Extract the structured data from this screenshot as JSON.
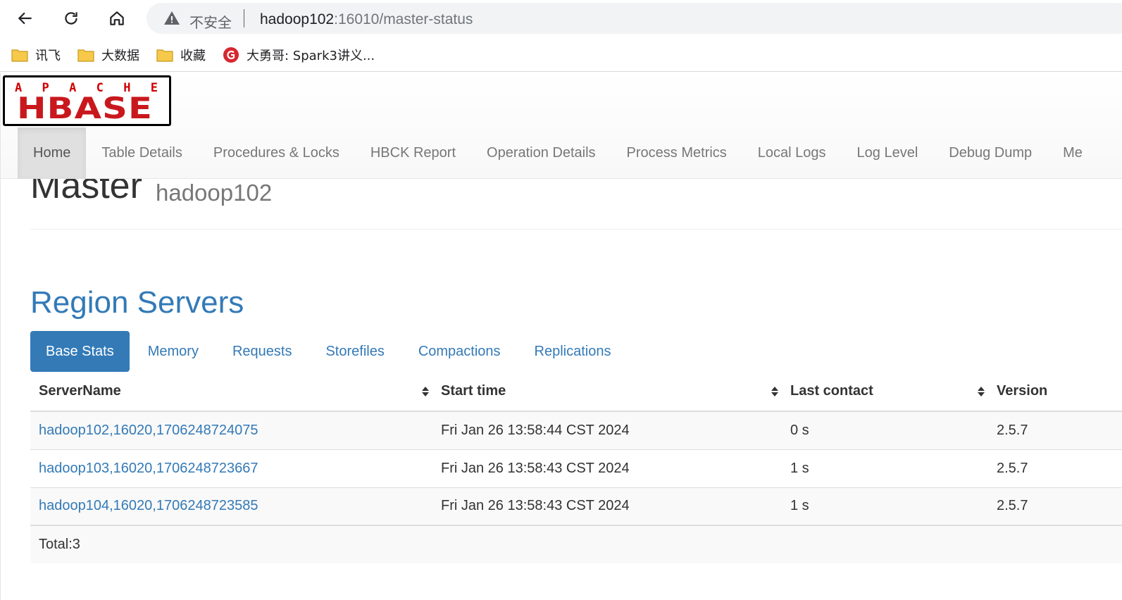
{
  "browser": {
    "insecure_label": "不安全",
    "url_host": "hadoop102",
    "url_rest": ":16010/master-status",
    "bookmarks": [
      {
        "label": "讯飞",
        "icon": "folder-icon"
      },
      {
        "label": "大数据",
        "icon": "folder-icon"
      },
      {
        "label": "收藏",
        "icon": "folder-icon"
      },
      {
        "label": "大勇哥: Spark3讲义...",
        "icon": "site-g-icon"
      }
    ]
  },
  "logo": {
    "top": "APACHE",
    "bottom": "HBASE"
  },
  "menu": [
    {
      "label": "Home"
    },
    {
      "label": "Table Details"
    },
    {
      "label": "Procedures & Locks"
    },
    {
      "label": "HBCK Report"
    },
    {
      "label": "Operation Details"
    },
    {
      "label": "Process Metrics"
    },
    {
      "label": "Local Logs"
    },
    {
      "label": "Log Level"
    },
    {
      "label": "Debug Dump"
    },
    {
      "label": "Me"
    }
  ],
  "master": {
    "title": "Master",
    "host": "hadoop102"
  },
  "region_servers": {
    "title": "Region Servers",
    "tabs": [
      "Base Stats",
      "Memory",
      "Requests",
      "Storefiles",
      "Compactions",
      "Replications"
    ],
    "columns": [
      "ServerName",
      "Start time",
      "Last contact",
      "Version"
    ],
    "rows": [
      {
        "server": "hadoop102,16020,1706248724075",
        "start": "Fri Jan 26 13:58:44 CST 2024",
        "contact": "0 s",
        "version": "2.5.7"
      },
      {
        "server": "hadoop103,16020,1706248723667",
        "start": "Fri Jan 26 13:58:43 CST 2024",
        "contact": "1 s",
        "version": "2.5.7"
      },
      {
        "server": "hadoop104,16020,1706248723585",
        "start": "Fri Jan 26 13:58:43 CST 2024",
        "contact": "1 s",
        "version": "2.5.7"
      }
    ],
    "total": "Total:3"
  },
  "colors": {
    "link": "#337ab7",
    "logo_red": "#c8181e"
  }
}
